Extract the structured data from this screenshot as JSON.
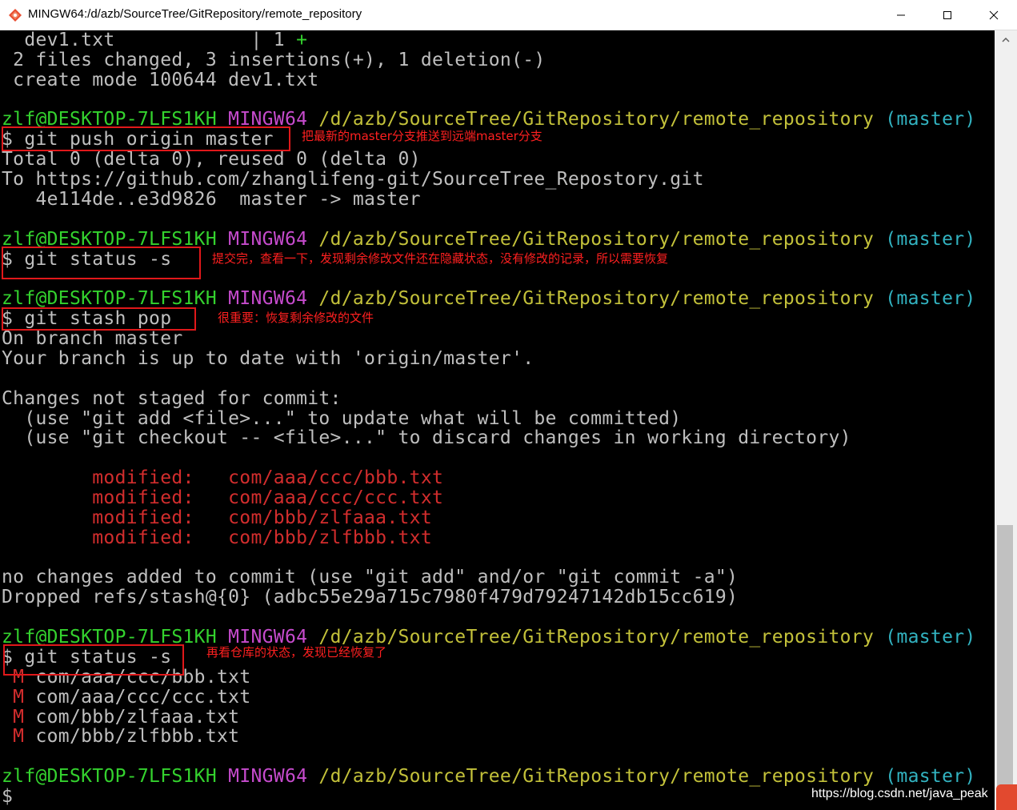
{
  "window": {
    "title": "MINGW64:/d/azb/SourceTree/GitRepository/remote_repository",
    "controls": [
      "minimize",
      "maximize",
      "close"
    ]
  },
  "terminal": {
    "lines": [
      [
        {
          "text": "  dev1.txt            | 1 ",
          "color": "gray"
        },
        {
          "text": "+",
          "color": "green"
        }
      ],
      [
        {
          "text": " 2 files changed, 3 insertions(+), 1 deletion(-)",
          "color": "gray"
        }
      ],
      [
        {
          "text": " create mode 100644 dev1.txt",
          "color": "gray"
        }
      ],
      [],
      [
        {
          "text": "zlf@DESKTOP-7LFS1KH ",
          "color": "green"
        },
        {
          "text": "MINGW64 ",
          "color": "magenta"
        },
        {
          "text": "/d/azb/SourceTree/GitRepository/remote_repository ",
          "color": "yellow"
        },
        {
          "text": "(master)",
          "color": "cyan"
        }
      ],
      [
        {
          "text": "$ git push origin master",
          "color": "gray"
        }
      ],
      [
        {
          "text": "Total 0 (delta 0), reused 0 (delta 0)",
          "color": "gray"
        }
      ],
      [
        {
          "text": "To https://github.com/zhanglifeng-git/SourceTree_Repostory.git",
          "color": "gray"
        }
      ],
      [
        {
          "text": "   4e114de..e3d9826  master -> master",
          "color": "gray"
        }
      ],
      [],
      [
        {
          "text": "zlf@DESKTOP-7LFS1KH ",
          "color": "green"
        },
        {
          "text": "MINGW64 ",
          "color": "magenta"
        },
        {
          "text": "/d/azb/SourceTree/GitRepository/remote_repository ",
          "color": "yellow"
        },
        {
          "text": "(master)",
          "color": "cyan"
        }
      ],
      [
        {
          "text": "$ git status -s",
          "color": "gray"
        }
      ],
      [],
      [
        {
          "text": "zlf@DESKTOP-7LFS1KH ",
          "color": "green"
        },
        {
          "text": "MINGW64 ",
          "color": "magenta"
        },
        {
          "text": "/d/azb/SourceTree/GitRepository/remote_repository ",
          "color": "yellow"
        },
        {
          "text": "(master)",
          "color": "cyan"
        }
      ],
      [
        {
          "text": "$ git stash pop",
          "color": "gray"
        }
      ],
      [
        {
          "text": "On branch master",
          "color": "gray"
        }
      ],
      [
        {
          "text": "Your branch is up to date with 'origin/master'.",
          "color": "gray"
        }
      ],
      [],
      [
        {
          "text": "Changes not staged for commit:",
          "color": "gray"
        }
      ],
      [
        {
          "text": "  (use \"git add <file>...\" to update what will be committed)",
          "color": "gray"
        }
      ],
      [
        {
          "text": "  (use \"git checkout -- <file>...\" to discard changes in working directory)",
          "color": "gray"
        }
      ],
      [],
      [
        {
          "text": "        modified:   com/aaa/ccc/bbb.txt",
          "color": "red"
        }
      ],
      [
        {
          "text": "        modified:   com/aaa/ccc/ccc.txt",
          "color": "red"
        }
      ],
      [
        {
          "text": "        modified:   com/bbb/zlfaaa.txt",
          "color": "red"
        }
      ],
      [
        {
          "text": "        modified:   com/bbb/zlfbbb.txt",
          "color": "red"
        }
      ],
      [],
      [
        {
          "text": "no changes added to commit (use \"git add\" and/or \"git commit -a\")",
          "color": "gray"
        }
      ],
      [
        {
          "text": "Dropped refs/stash@{0} (adbc55e29a715c7980f479d79247142db15cc619)",
          "color": "gray"
        }
      ],
      [],
      [
        {
          "text": "zlf@DESKTOP-7LFS1KH ",
          "color": "green"
        },
        {
          "text": "MINGW64 ",
          "color": "magenta"
        },
        {
          "text": "/d/azb/SourceTree/GitRepository/remote_repository ",
          "color": "yellow"
        },
        {
          "text": "(master)",
          "color": "cyan"
        }
      ],
      [
        {
          "text": "$ git status -s",
          "color": "gray"
        }
      ],
      [
        {
          "text": " M",
          "color": "red"
        },
        {
          "text": " com/aaa/ccc/bbb.txt",
          "color": "gray"
        }
      ],
      [
        {
          "text": " M",
          "color": "red"
        },
        {
          "text": " com/aaa/ccc/ccc.txt",
          "color": "gray"
        }
      ],
      [
        {
          "text": " M",
          "color": "red"
        },
        {
          "text": " com/bbb/zlfaaa.txt",
          "color": "gray"
        }
      ],
      [
        {
          "text": " M",
          "color": "red"
        },
        {
          "text": " com/bbb/zlfbbb.txt",
          "color": "gray"
        }
      ],
      [],
      [
        {
          "text": "zlf@DESKTOP-7LFS1KH ",
          "color": "green"
        },
        {
          "text": "MINGW64 ",
          "color": "magenta"
        },
        {
          "text": "/d/azb/SourceTree/GitRepository/remote_repository ",
          "color": "yellow"
        },
        {
          "text": "(master)",
          "color": "cyan"
        }
      ],
      [
        {
          "text": "$",
          "color": "gray"
        }
      ]
    ]
  },
  "annotations": [
    "把最新的master分支推送到远端master分支",
    "提交完，查看一下，发现剩余修改文件还在隐藏状态，没有修改的记录，所以需要恢复",
    "很重要：恢复剩余修改的文件",
    "再看仓库的状态，发现已经恢复了"
  ],
  "watermark": "https://blog.csdn.net/java_peak",
  "colors": {
    "background": "#000000",
    "text": "#bfbfbf",
    "green": "#34d22e",
    "magenta": "#c64bcd",
    "yellow": "#c3c13a",
    "cyan": "#32b3c1",
    "red": "#d22d2d",
    "annotation": "#ff2020"
  }
}
